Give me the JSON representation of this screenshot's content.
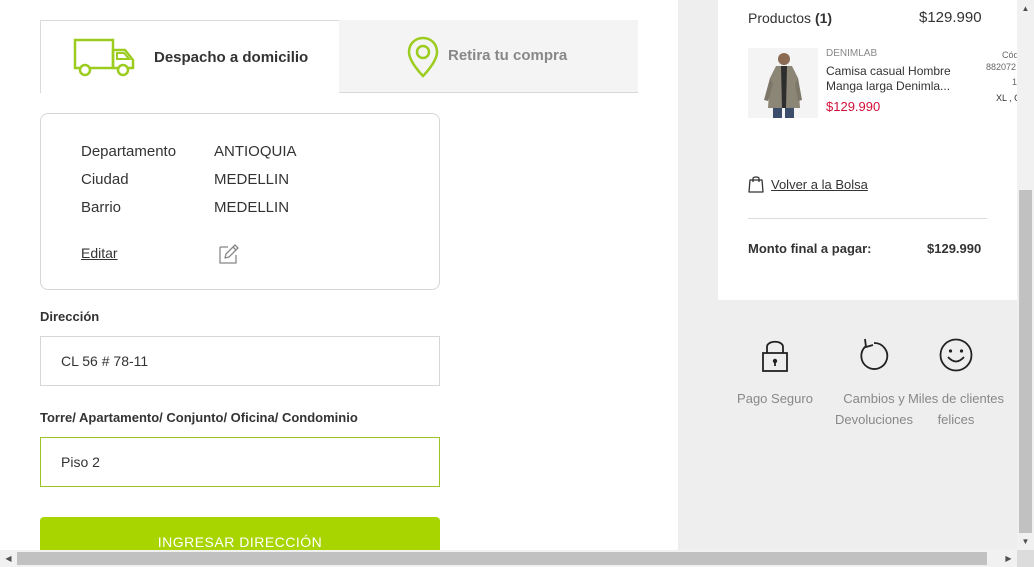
{
  "tabs": {
    "home_delivery": "Despacho a domicilio",
    "store_pickup": "Retira tu compra"
  },
  "address_card": {
    "rows": [
      {
        "label": "Departamento",
        "value": "ANTIOQUIA"
      },
      {
        "label": "Ciudad",
        "value": "MEDELLIN"
      },
      {
        "label": "Barrio",
        "value": "MEDELLIN"
      }
    ],
    "edit_label": "Editar"
  },
  "form": {
    "address_label": "Dirección",
    "address_value": "CL 56 # 78-11",
    "unit_label": "Torre/ Apartamento/ Conjunto/ Oficina/ Condominio",
    "unit_value": "Piso 2",
    "submit_label": "INGRESAR DIRECCIÓN"
  },
  "summary": {
    "products_label": "Productos",
    "products_count": "(1)",
    "products_total": "$129.990",
    "product": {
      "brand": "DENIMLAB",
      "name": "Camisa casual Hombre Manga larga Denimla...",
      "price": "$129.990",
      "code_label": "Cód",
      "code_value": "882072",
      "quantity": "1",
      "size": "XL , C"
    },
    "back_link": "Volver a la Bolsa",
    "final_label": "Monto final a pagar:",
    "final_value": "$129.990"
  },
  "benefits": [
    {
      "icon": "lock-icon",
      "text": "Pago Seguro"
    },
    {
      "icon": "rotate-icon",
      "text": "Cambios y Devoluciones"
    },
    {
      "icon": "smiley-icon",
      "text": "Miles de clientes felices"
    }
  ],
  "colors": {
    "accent_green": "#a8d400",
    "price_red": "#d0103a",
    "panel_gray": "#eeeeee"
  }
}
